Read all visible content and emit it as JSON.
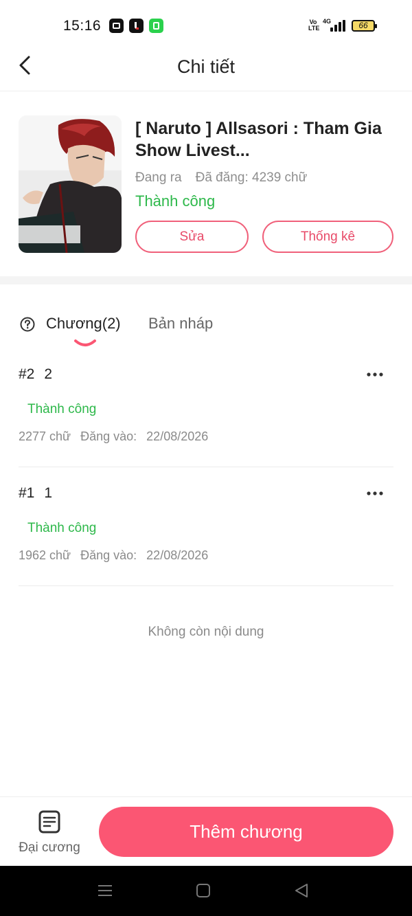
{
  "status_bar": {
    "time": "15:16",
    "app_icons": [
      "capcut-icon",
      "tiktok-icon",
      "calculator-icon"
    ],
    "volte": "Vo LTE",
    "network": "4G",
    "battery": "66"
  },
  "header": {
    "title": "Chi tiết"
  },
  "book": {
    "title": "[ Naruto ] Allsasori : Tham Gia Show Livest...",
    "state": "Đang ra",
    "words_posted": "Đã đăng: 4239 chữ",
    "status": "Thành công",
    "edit_label": "Sửa",
    "stats_label": "Thống kê"
  },
  "tabs": {
    "chapters": "Chương(2)",
    "drafts": "Bản nháp"
  },
  "chapters": [
    {
      "number": "#2",
      "title": "2",
      "status": "Thành công",
      "words": "2277 chữ",
      "posted_label": "Đăng vào:",
      "date": "22/08/2026"
    },
    {
      "number": "#1",
      "title": "1",
      "status": "Thành công",
      "words": "1962 chữ",
      "posted_label": "Đăng vào:",
      "date": "22/08/2026"
    }
  ],
  "empty_message": "Không còn nội dung",
  "bottom": {
    "outline_label": "Đại cương",
    "add_chapter_label": "Thêm chương"
  },
  "colors": {
    "accent": "#fb5673",
    "success": "#2db84a",
    "outline": "#f0607a"
  }
}
